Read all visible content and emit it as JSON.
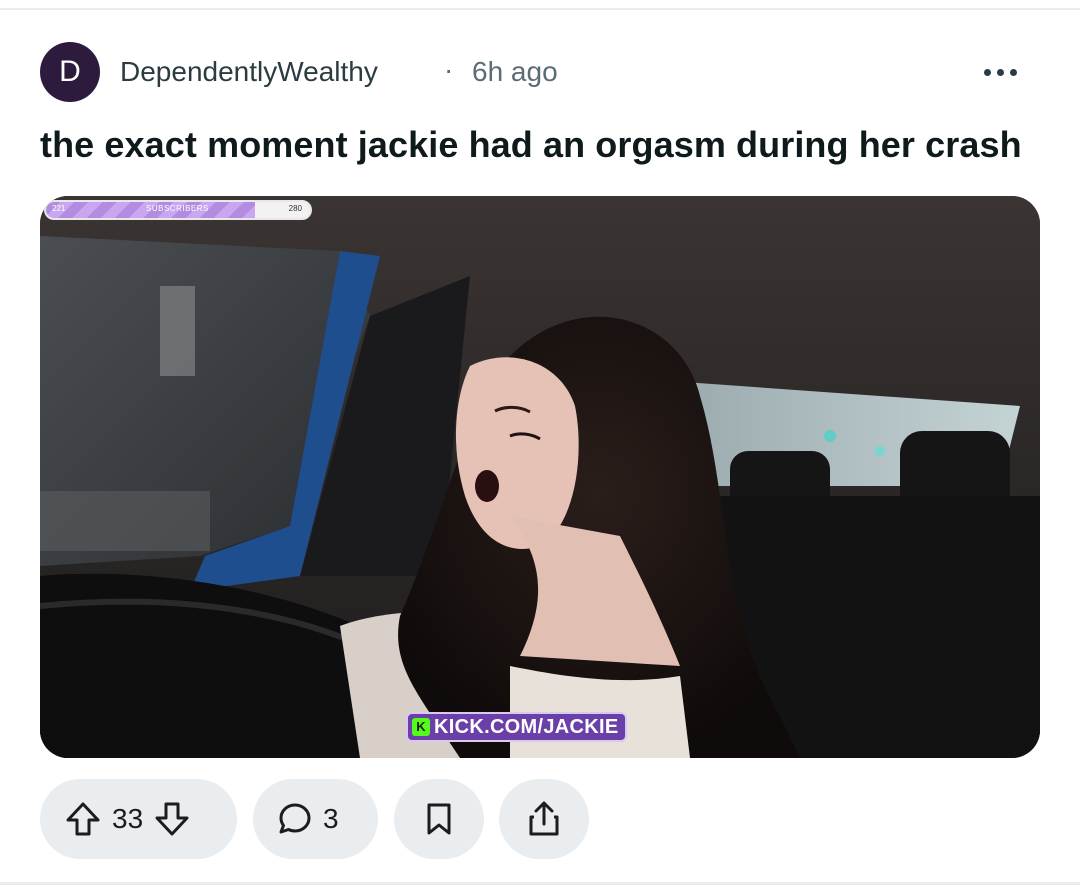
{
  "post": {
    "avatar_letter": "D",
    "author": "DependentlyWealthy",
    "separator": "·",
    "age": "6h ago",
    "title": "the exact moment jackie had an orgasm during her crash"
  },
  "media": {
    "subscriber_bar": {
      "left_value": "221",
      "label": "SUBSCRIBERS",
      "right_value": "280",
      "progress": 0.79
    },
    "watermark": "KICK.COM/JACKIE",
    "watermark_logo": "K"
  },
  "actions": {
    "upvotes": "33",
    "comments": "3"
  },
  "colors": {
    "avatar_bg": "#2d1b3d",
    "pill_bg": "#eaedef",
    "kick_green": "#53fc18",
    "kick_purple": "#6b3fa8"
  },
  "icons": [
    "more-options-icon",
    "upvote-icon",
    "downvote-icon",
    "comment-icon",
    "save-icon",
    "share-icon"
  ]
}
